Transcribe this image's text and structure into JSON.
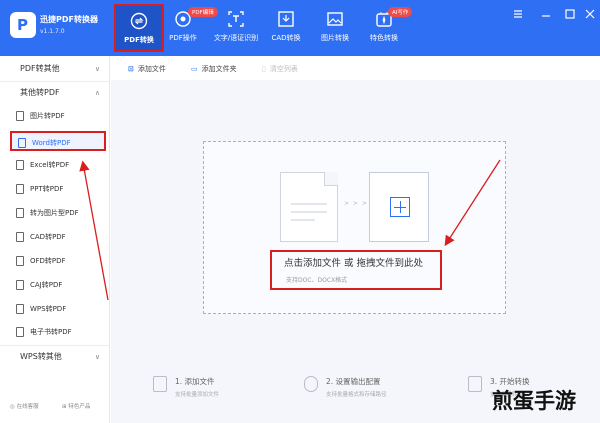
{
  "app": {
    "logo_letter": "P",
    "name": "迅捷PDF转换器",
    "version": "v1.1.7.0"
  },
  "tabs": [
    {
      "label": "PDF转换",
      "icon": "convert-icon",
      "active": true
    },
    {
      "label": "PDF操作",
      "icon": "pdf-tools-icon",
      "badge": "PDF编辑"
    },
    {
      "label": "文字/语证识别",
      "icon": "ocr-icon"
    },
    {
      "label": "CAD转换",
      "icon": "cad-icon"
    },
    {
      "label": "图片转换",
      "icon": "image-icon"
    },
    {
      "label": "特色转换",
      "icon": "special-icon",
      "badge": "AI写作"
    }
  ],
  "sidebar": {
    "groups": [
      {
        "label": "PDF转其他",
        "state": "collapsed"
      },
      {
        "label": "其他转PDF",
        "state": "expanded"
      },
      {
        "label": "WPS转其他",
        "state": "collapsed"
      }
    ],
    "items": [
      {
        "label": "图片转PDF"
      },
      {
        "label": "Word转PDF",
        "selected": true
      },
      {
        "label": "Excel转PDF"
      },
      {
        "label": "PPT转PDF"
      },
      {
        "label": "转为图片型PDF"
      },
      {
        "label": "CAD转PDF"
      },
      {
        "label": "OFD转PDF"
      },
      {
        "label": "CAJ转PDF"
      },
      {
        "label": "WPS转PDF"
      },
      {
        "label": "电子书转PDF"
      }
    ],
    "footer": {
      "service": "在线客服",
      "features": "特色产品"
    }
  },
  "toolbar": {
    "add_file": "添加文件",
    "add_folder": "添加文件夹",
    "clear_list": "清空列表"
  },
  "dropzone": {
    "arrows": "> > >",
    "main_text": "点击添加文件 或 拖拽文件到此处",
    "sub_text": "支持DOC、DOCX格式"
  },
  "steps": [
    {
      "title": "1. 添加文件",
      "desc": "支持批量添加文件"
    },
    {
      "title": "2. 设置输出配置",
      "desc": "支持批量格式和存储路径"
    },
    {
      "title": "3. 开始转换",
      "desc": "支持批量转换"
    }
  ],
  "watermark": "煎蛋手游",
  "colors": {
    "accent": "#2f6ff4",
    "annotation": "#d81e1e",
    "badge": "#f04b4b"
  }
}
